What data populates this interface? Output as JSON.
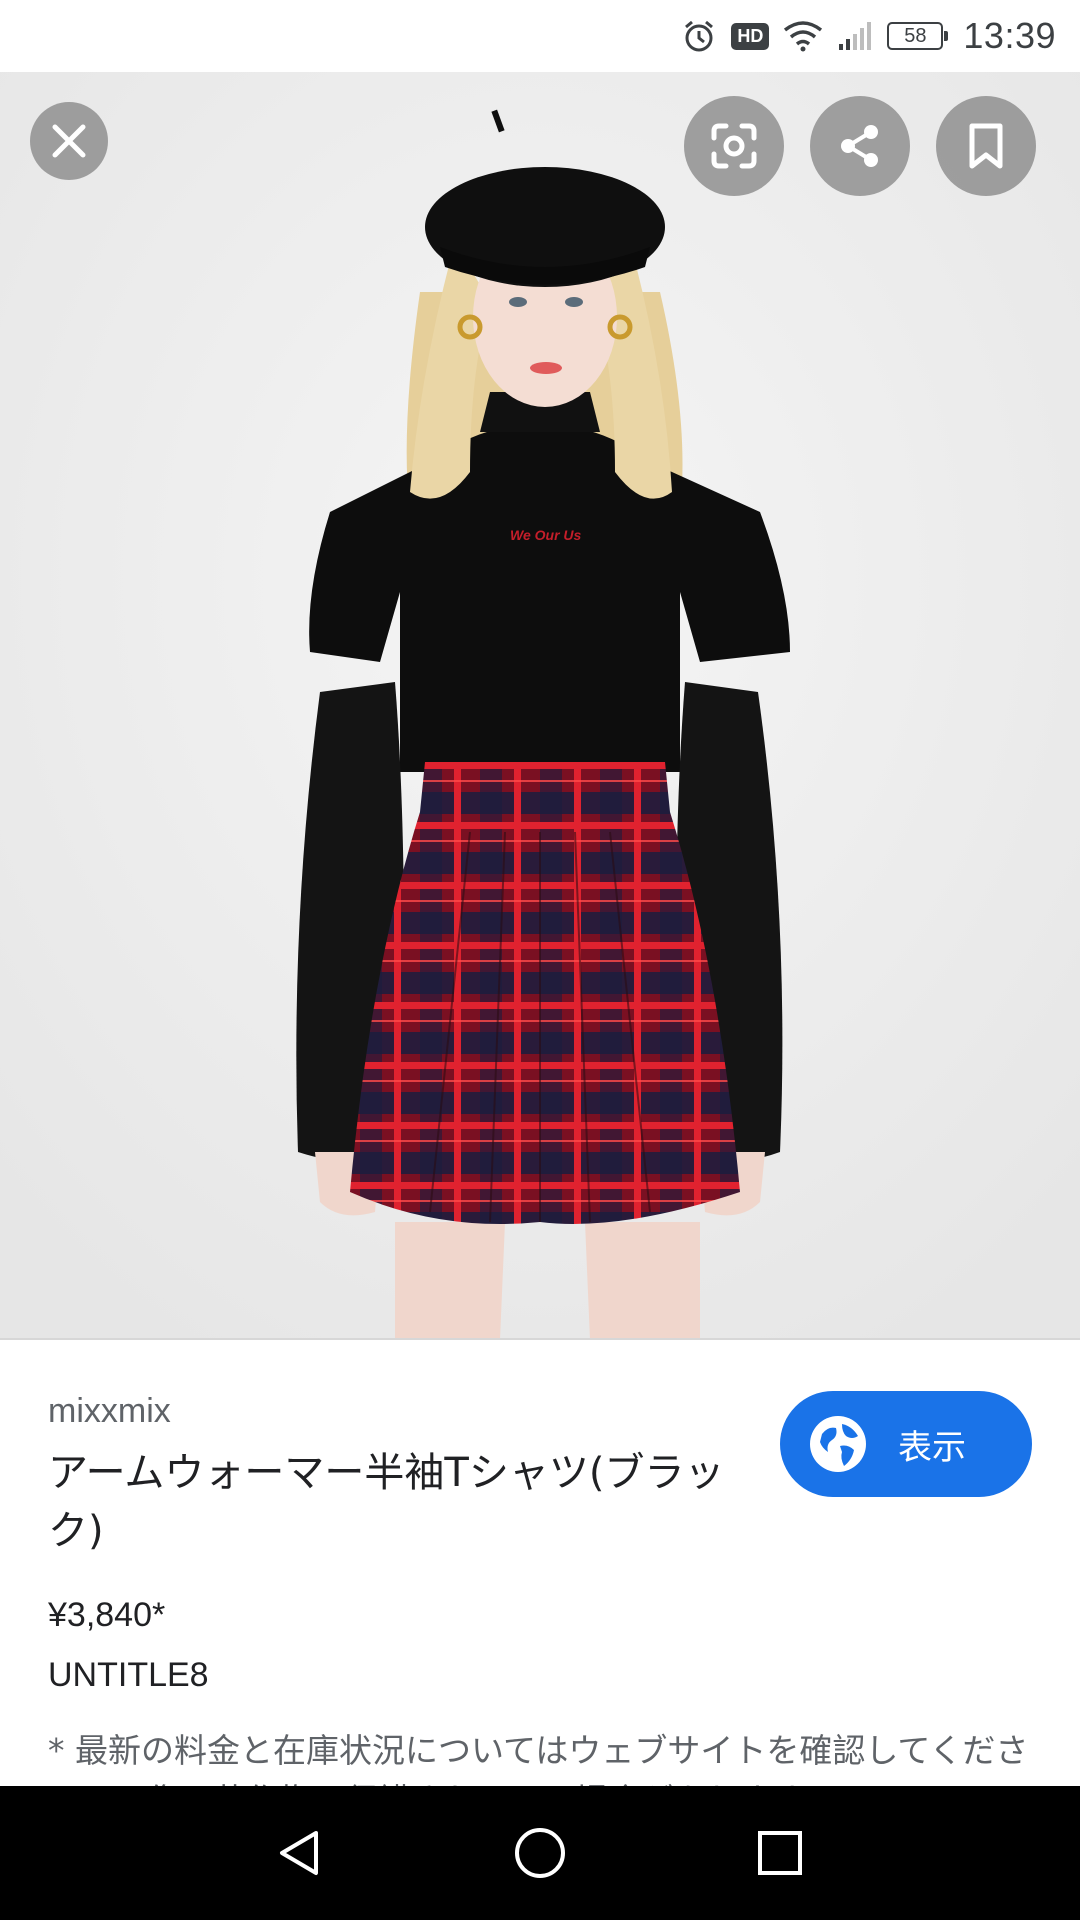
{
  "status_bar": {
    "time": "13:39",
    "battery": "58",
    "hd": "HD",
    "icons": [
      "alarm-icon",
      "hd-icon",
      "wifi-icon",
      "signal-icon",
      "battery-icon"
    ]
  },
  "image_overlay": {
    "shirt_print": "We Our Us",
    "buttons": [
      "close-icon",
      "lens-icon",
      "share-icon",
      "bookmark-icon"
    ]
  },
  "result": {
    "site": "mixxmix",
    "title": "アームウォーマー半袖Tシャツ(ブラック)",
    "view_label": "表示",
    "price": "¥3,840*",
    "seller": "UNTITLE8",
    "disclaimer": "* 最新の料金と在庫状況についてはウェブサイトを確認してください。画像は著作権で保護されている場合があります。"
  },
  "colors": {
    "accent": "#1a73e8",
    "navbar": "#000000",
    "overlay_button": "#808080"
  },
  "nav": {
    "icons": [
      "back-icon",
      "home-icon",
      "recents-icon"
    ]
  }
}
